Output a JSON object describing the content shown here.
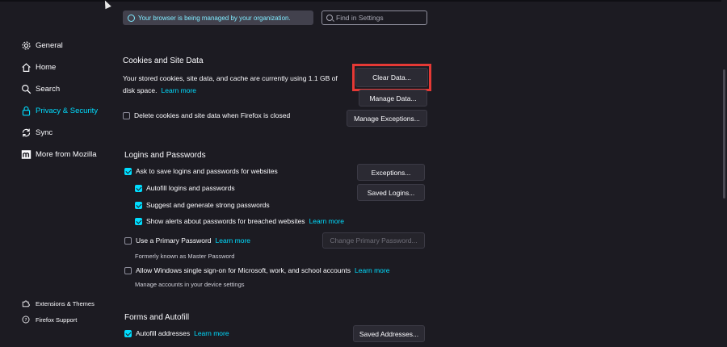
{
  "banner": {
    "managed_text": "Your browser is being managed by your organization."
  },
  "search": {
    "placeholder": "Find in Settings"
  },
  "sidebar": {
    "items": [
      {
        "label": "General",
        "icon": "gear-icon"
      },
      {
        "label": "Home",
        "icon": "home-icon"
      },
      {
        "label": "Search",
        "icon": "search-icon"
      },
      {
        "label": "Privacy & Security",
        "icon": "lock-icon",
        "active": true
      },
      {
        "label": "Sync",
        "icon": "sync-icon"
      },
      {
        "label": "More from Mozilla",
        "icon": "mozilla-icon"
      }
    ],
    "footer": [
      {
        "label": "Extensions & Themes",
        "icon": "puzzle-icon"
      },
      {
        "label": "Firefox Support",
        "icon": "help-icon"
      }
    ]
  },
  "cookies": {
    "title": "Cookies and Site Data",
    "desc_line1": "Your stored cookies, site data, and cache are currently using 1.1 GB of",
    "desc_line2": "disk space.",
    "learn_more": "Learn more",
    "clear_data": "Clear Data...",
    "manage_data": "Manage Data...",
    "delete_on_close": "Delete cookies and site data when Firefox is closed",
    "manage_exceptions": "Manage Exceptions..."
  },
  "logins": {
    "title": "Logins and Passwords",
    "ask_save": "Ask to save logins and passwords for websites",
    "autofill": "Autofill logins and passwords",
    "suggest": "Suggest and generate strong passwords",
    "alerts": "Show alerts about passwords for breached websites",
    "alerts_learn": "Learn more",
    "exceptions": "Exceptions...",
    "saved_logins": "Saved Logins...",
    "primary_pw": "Use a Primary Password",
    "primary_learn": "Learn more",
    "primary_note": "Formerly known as Master Password",
    "change_primary": "Change Primary Password...",
    "windows_sso": "Allow Windows single sign-on for Microsoft, work, and school accounts",
    "windows_learn": "Learn more",
    "windows_note": "Manage accounts in your device settings"
  },
  "forms": {
    "title": "Forms and Autofill",
    "autofill_addresses": "Autofill addresses",
    "learn_more": "Learn more",
    "saved_addresses": "Saved Addresses..."
  },
  "colors": {
    "accent": "#00ddff",
    "highlight": "#e53935",
    "background": "#1c1b22"
  }
}
